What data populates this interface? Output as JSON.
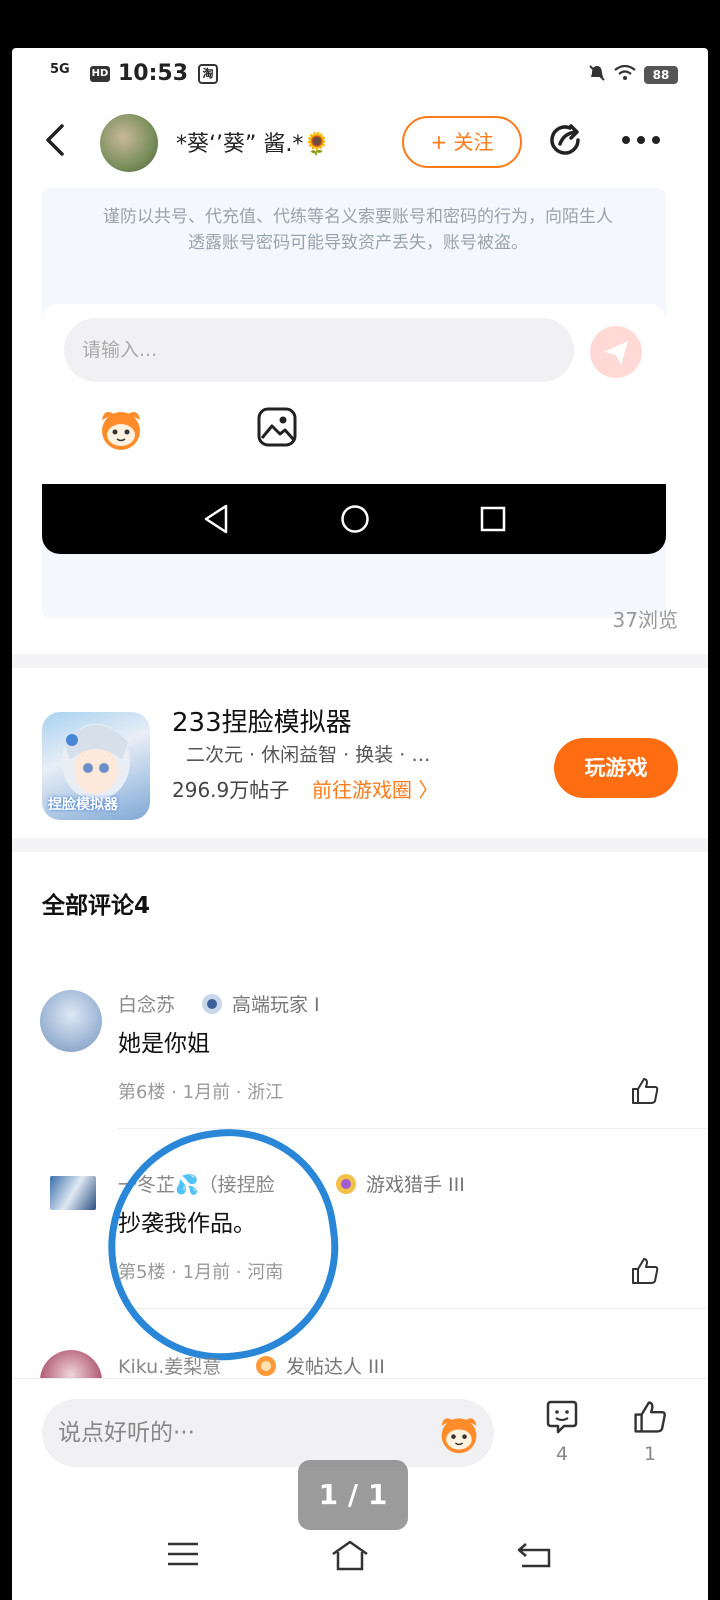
{
  "status_bar": {
    "signal": "5G",
    "hd": "HD",
    "time": "10:53",
    "app_badge": "淘",
    "battery": "88"
  },
  "header": {
    "back_icon": "chevron-left-icon",
    "title": "*葵‘’葵” 酱.*🌻",
    "follow_label": "+ 关注"
  },
  "warning": {
    "text": "谨防以共号、代充值、代练等名义索要账号和密码的行为，向陌生人透露账号密码可能导致资产丢失，账号被盗。"
  },
  "reply_box": {
    "placeholder": "请输入..."
  },
  "post": {
    "views": "37浏览"
  },
  "game": {
    "name": "233捏脸模拟器",
    "icon_label": "捏脸模拟器",
    "tags": "二次元 · 休闲益智 · 换装 · …",
    "posts": "296.9万帖子",
    "link": "前往游戏圈 〉",
    "play_label": "玩游戏"
  },
  "comments_title": "全部评论4",
  "comments": [
    {
      "name": "白念苏",
      "level": "高端玩家 I",
      "text": "她是你姐",
      "meta": "第6楼 · 1月前 · 浙江"
    },
    {
      "name": "一冬芷💦（接捏脸",
      "level": "游戏猎手 III",
      "text": "抄袭我作品。",
      "meta": "第5楼 · 1月前 · 河南"
    },
    {
      "name": "Kiku.姜梨意",
      "level": "发帖达人 III"
    }
  ],
  "bottom": {
    "say_placeholder": "说点好听的···",
    "comment_count": "4",
    "like_count": "1"
  },
  "page_indicator": "1 / 1",
  "colors": {
    "accent": "#ff7a1a",
    "play_button": "#ff6d12",
    "annotation_circle": "#2a86d6"
  }
}
